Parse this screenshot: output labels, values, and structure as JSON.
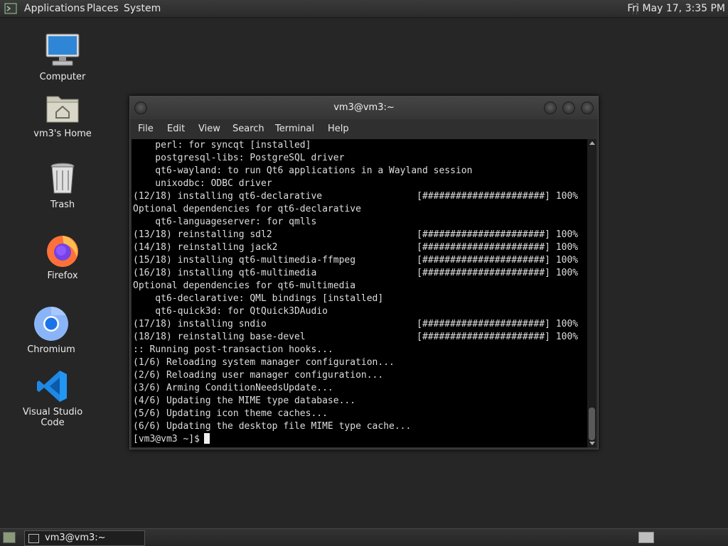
{
  "top_panel": {
    "menus": [
      "Applications",
      "Places",
      "System"
    ],
    "clock": "Fri May 17,  3:35 PM",
    "logo_icon": "terminal-logo-icon"
  },
  "desktop_icons": [
    {
      "label": "Computer",
      "icon": "computer-icon"
    },
    {
      "label": "vm3's Home",
      "icon": "home-folder-icon"
    },
    {
      "label": "Trash",
      "icon": "trash-icon"
    },
    {
      "label": "Firefox",
      "icon": "firefox-icon"
    },
    {
      "label": "Chromium",
      "icon": "chromium-icon"
    },
    {
      "label": "Visual Studio Code",
      "icon": "vscode-icon"
    }
  ],
  "terminal": {
    "title": "vm3@vm3:~",
    "menu": [
      "File",
      "Edit",
      "View",
      "Search",
      "Terminal",
      "Help"
    ],
    "lines": [
      "    perl: for syncqt [installed]",
      "    postgresql-libs: PostgreSQL driver",
      "    qt6-wayland: to run Qt6 applications in a Wayland session",
      "    unixodbc: ODBC driver",
      "(12/18) installing qt6-declarative                 [######################] 100%",
      "Optional dependencies for qt6-declarative",
      "    qt6-languageserver: for qmlls",
      "(13/18) reinstalling sdl2                          [######################] 100%",
      "(14/18) reinstalling jack2                         [######################] 100%",
      "(15/18) installing qt6-multimedia-ffmpeg           [######################] 100%",
      "(16/18) installing qt6-multimedia                  [######################] 100%",
      "Optional dependencies for qt6-multimedia",
      "    qt6-declarative: QML bindings [installed]",
      "    qt6-quick3d: for QtQuick3DAudio",
      "(17/18) installing sndio                           [######################] 100%",
      "(18/18) reinstalling base-devel                    [######################] 100%",
      ":: Running post-transaction hooks...",
      "(1/6) Reloading system manager configuration...",
      "(2/6) Reloading user manager configuration...",
      "(3/6) Arming ConditionNeedsUpdate...",
      "(4/6) Updating the MIME type database...",
      "(5/6) Updating icon theme caches...",
      "(6/6) Updating the desktop file MIME type cache..."
    ],
    "prompt": "[vm3@vm3 ~]$"
  },
  "taskbar": {
    "window_label": "vm3@vm3:~"
  }
}
